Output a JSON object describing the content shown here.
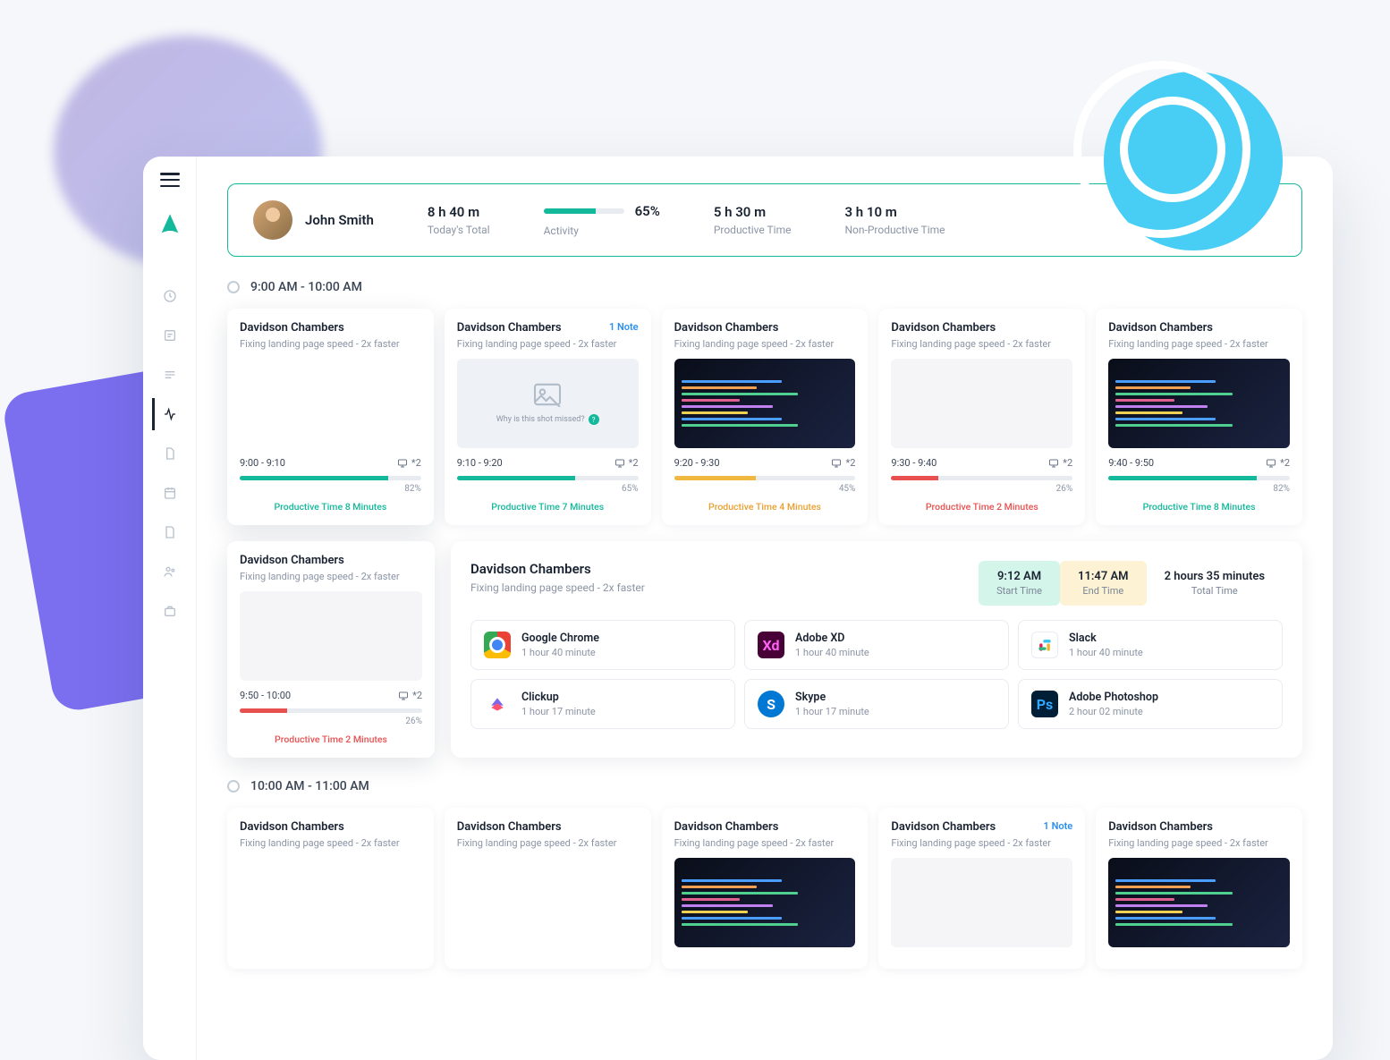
{
  "user": {
    "name": "John Smith"
  },
  "summary": {
    "today_total": "8 h 40 m",
    "today_total_label": "Today's Total",
    "activity_pct": "65%",
    "activity_label": "Activity",
    "productive": "5 h 30 m",
    "productive_label": "Productive Time",
    "nonproductive": "3 h 10 m",
    "nonproductive_label": "Non-Productive Time"
  },
  "timeblocks": {
    "block1": "9:00 AM - 10:00 AM",
    "block2": "10:00 AM - 11:00 AM"
  },
  "cards": [
    {
      "title": "Davidson Chambers",
      "subtitle": "Fixing landing page speed - 2x faster",
      "range": "9:00 - 9:10",
      "count": "*2",
      "pct": "82%",
      "prod": "Productive Time 8 Minutes",
      "prod_color": "green",
      "fill": 82,
      "fill_color": "green",
      "shot": "grid"
    },
    {
      "title": "Davidson Chambers",
      "subtitle": "Fixing landing page speed - 2x faster",
      "note": "1 Note",
      "range": "9:10 - 9:20",
      "count": "*2",
      "pct": "65%",
      "prod": "Productive Time 7 Minutes",
      "prod_color": "green",
      "fill": 65,
      "fill_color": "green",
      "shot": "empty",
      "empty_text": "Why is this shot missed?"
    },
    {
      "title": "Davidson Chambers",
      "subtitle": "Fixing landing page speed - 2x faster",
      "range": "9:20 - 9:30",
      "count": "*2",
      "pct": "45%",
      "prod": "Productive Time 4 Minutes",
      "prod_color": "yellow",
      "fill": 45,
      "fill_color": "yellow",
      "shot": "code"
    },
    {
      "title": "Davidson Chambers",
      "subtitle": "Fixing landing page speed - 2x faster",
      "range": "9:30 - 9:40",
      "count": "*2",
      "pct": "26%",
      "prod": "Productive Time 2 Minutes",
      "prod_color": "red",
      "fill": 26,
      "fill_color": "red",
      "shot": "web"
    },
    {
      "title": "Davidson Chambers",
      "subtitle": "Fixing landing page speed - 2x faster",
      "range": "9:40 - 9:50",
      "count": "*2",
      "pct": "82%",
      "prod": "Productive Time 8 Minutes",
      "prod_color": "green",
      "fill": 82,
      "fill_color": "green",
      "shot": "code"
    }
  ],
  "card_extra": {
    "title": "Davidson Chambers",
    "subtitle": "Fixing landing page speed - 2x faster",
    "range": "9:50 - 10:00",
    "count": "*2",
    "pct": "26%",
    "prod": "Productive Time 2 Minutes",
    "prod_color": "red",
    "fill": 26,
    "fill_color": "red"
  },
  "detail": {
    "title": "Davidson Chambers",
    "subtitle": "Fixing landing page speed - 2x faster",
    "start": "9:12 AM",
    "start_label": "Start Time",
    "end": "11:47 AM",
    "end_label": "End Time",
    "total": "2 hours 35 minutes",
    "total_label": "Total Time"
  },
  "apps": [
    {
      "name": "Google Chrome",
      "time": "1 hour 40 minute",
      "icon": "chrome"
    },
    {
      "name": "Adobe XD",
      "time": "1 hour 40 minute",
      "icon": "xd",
      "glyph": "Xd"
    },
    {
      "name": "Slack",
      "time": "1 hour 40 minute",
      "icon": "slack"
    },
    {
      "name": "Clickup",
      "time": "1 hour 17 minute",
      "icon": "clickup"
    },
    {
      "name": "Skype",
      "time": "1 hour 17 minute",
      "icon": "skype",
      "glyph": "S"
    },
    {
      "name": "Adobe Photoshop",
      "time": "2 hour 02 minute",
      "icon": "ps",
      "glyph": "Ps"
    }
  ],
  "cards2": [
    {
      "title": "Davidson Chambers",
      "subtitle": "Fixing landing page speed - 2x faster"
    },
    {
      "title": "Davidson Chambers",
      "subtitle": "Fixing landing page speed - 2x faster"
    },
    {
      "title": "Davidson Chambers",
      "subtitle": "Fixing landing page speed - 2x faster"
    },
    {
      "title": "Davidson Chambers",
      "subtitle": "Fixing landing page speed - 2x faster",
      "note": "1 Note"
    },
    {
      "title": "Davidson Chambers",
      "subtitle": "Fixing landing page speed - 2x faster"
    }
  ]
}
